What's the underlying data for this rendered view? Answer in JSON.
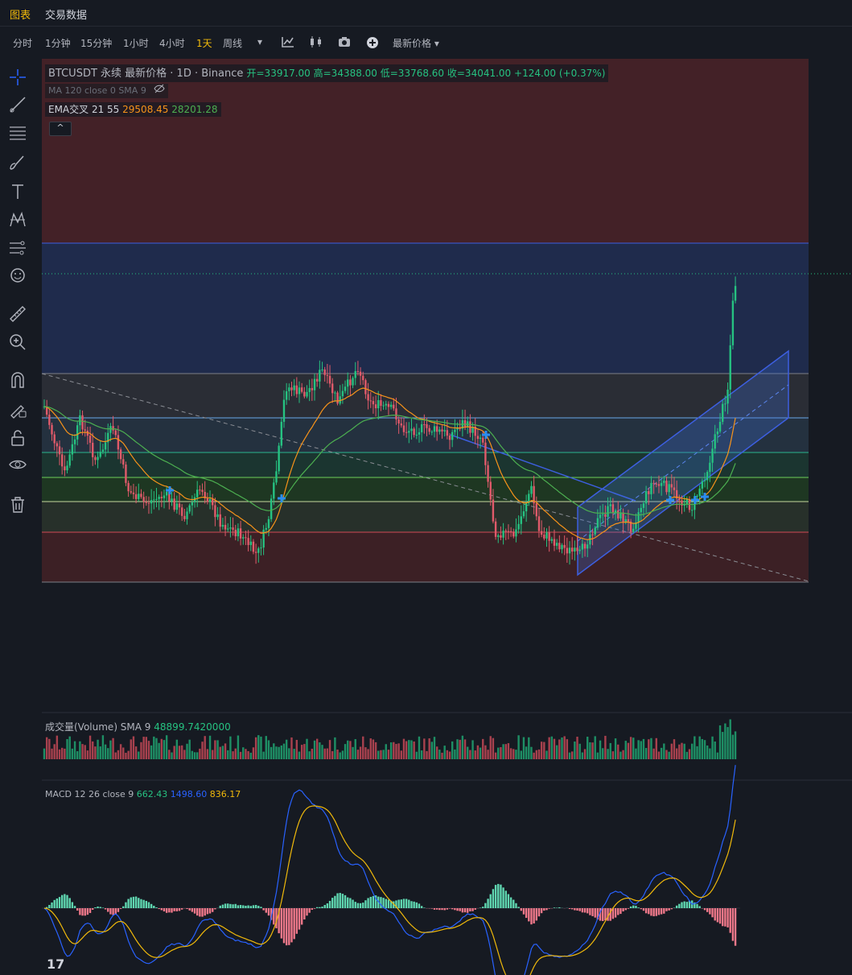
{
  "topnav": {
    "tab_chart": "图表",
    "tab_trading_data": "交易数据"
  },
  "toolbar": {
    "intervals": [
      "分时",
      "1分钟",
      "15分钟",
      "1小时",
      "4小时",
      "1天",
      "周线"
    ],
    "active_interval": "1天",
    "price_type": "最新价格"
  },
  "legend": {
    "symbol": "BTCUSDT 永续 最新价格 · 1D · Binance",
    "ohlc": "开=33917.00 高=34388.00 低=33768.60 收=34041.00 +124.00 (+0.37%)",
    "ma_line": "MA 120 close 0 SMA 9",
    "ema_label": "EMA交叉 21 55",
    "ema_fast": "29508.45",
    "ema_slow": "28201.28",
    "collapse": "^"
  },
  "volume_legend": {
    "label": "成交量(Volume) SMA 9",
    "value": "48899.7420000"
  },
  "macd_legend": {
    "label": "MACD 12 26 close 9",
    "v1": "662.43",
    "v2": "1498.60",
    "v3": "836.17"
  },
  "logo_text": "17",
  "colors": {
    "bg": "#161a22",
    "up": "#26c281",
    "down": "#e05a6a",
    "accent": "#f0b90b",
    "ema_fast": "#f7931a",
    "ema_slow": "#4caf50",
    "macd": "#2962ff"
  },
  "chart_data": {
    "type": "candlestick",
    "symbol": "BTCUSDT",
    "interval": "1D",
    "last": {
      "open": 33917.0,
      "high": 34388.0,
      "low": 33768.6,
      "close": 34041.0,
      "change": 124.0,
      "change_pct": 0.37
    }
  }
}
